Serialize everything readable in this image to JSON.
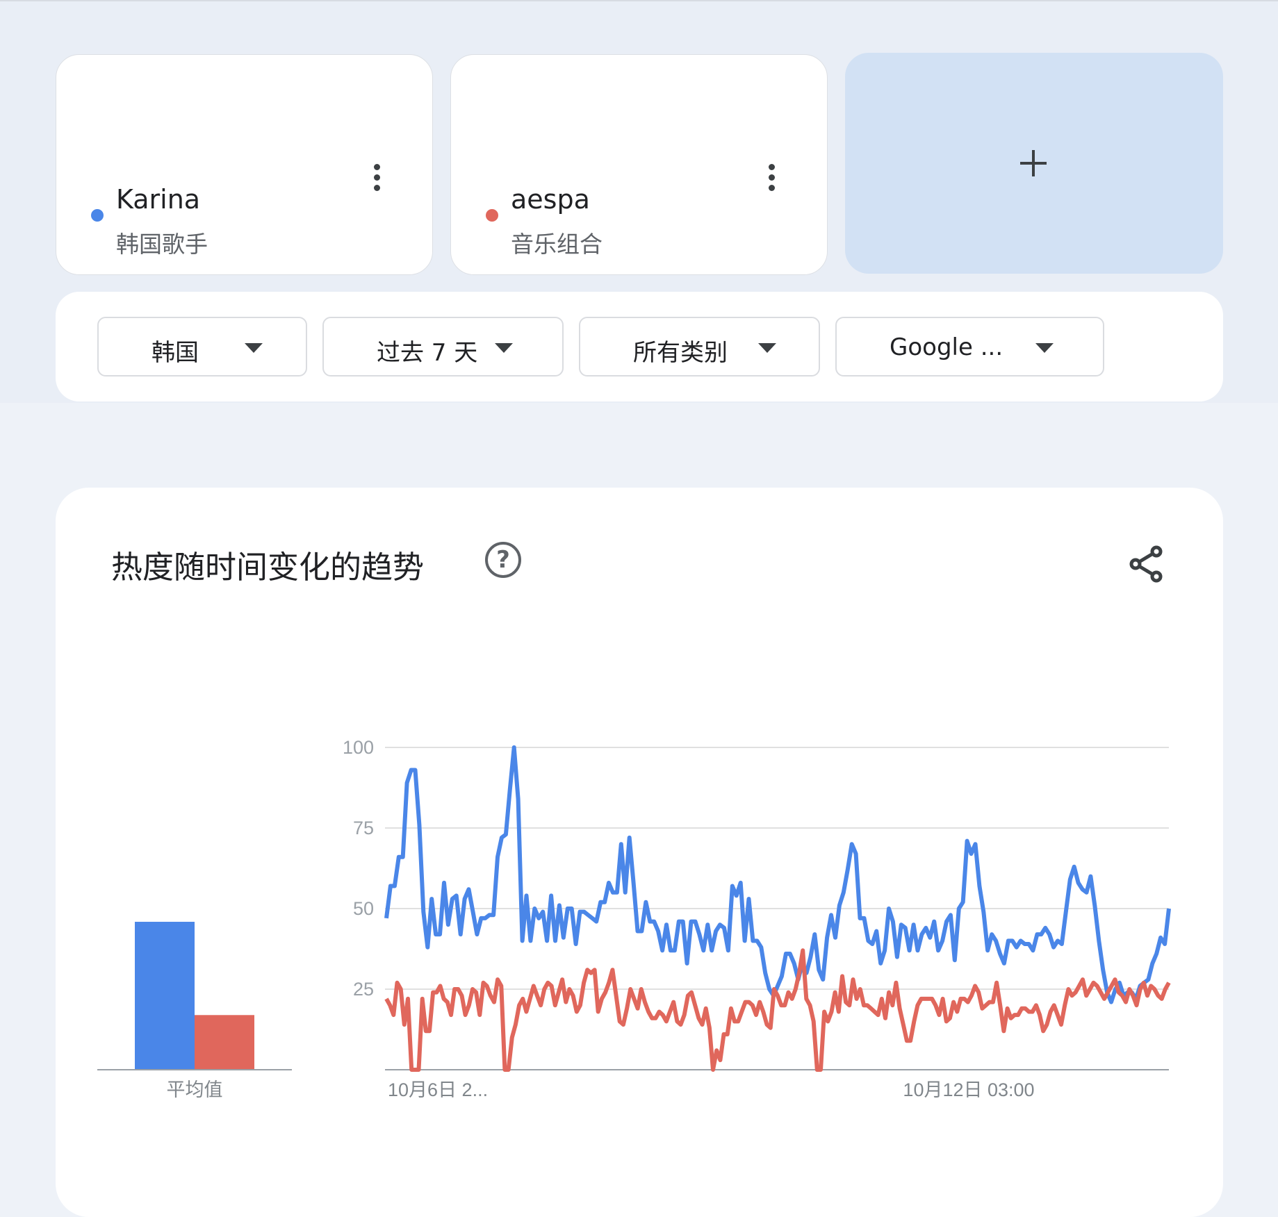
{
  "colors": {
    "karina": "#4a86e8",
    "aespa": "#e0675c"
  },
  "terms": [
    {
      "name": "Karina",
      "category": "韩国歌手"
    },
    {
      "name": "aespa",
      "category": "音乐组合"
    }
  ],
  "add_icon": "plus-icon",
  "filters": {
    "region": "韩国",
    "time": "过去 7 天",
    "category": "所有类别",
    "property": "Google ..."
  },
  "chart_section": {
    "title": "热度随时间变化的趋势",
    "help_icon": "help-circle-icon",
    "share_icon": "share-icon"
  },
  "chart_data": [
    {
      "type": "bar",
      "categories": [
        "平均值"
      ],
      "series": [
        {
          "name": "Karina",
          "values": [
            46
          ]
        },
        {
          "name": "aespa",
          "values": [
            17
          ]
        }
      ],
      "ylim": [
        0,
        100
      ]
    },
    {
      "type": "line",
      "x_tick_labels": [
        "10月6日 2...",
        "10月12日 03:00"
      ],
      "yticks": [
        25,
        50,
        75,
        100
      ],
      "ylim": [
        0,
        100
      ],
      "grid": true,
      "series": [
        {
          "name": "Karina",
          "values": [
            47,
            57,
            57,
            66,
            66,
            89,
            93,
            93,
            76,
            49,
            38,
            53,
            42,
            42,
            58,
            45,
            53,
            54,
            42,
            53,
            56,
            49,
            42,
            47,
            47,
            48,
            48,
            66,
            72,
            73,
            87,
            100,
            84,
            40,
            54,
            40,
            50,
            47,
            49,
            40,
            54,
            40,
            51,
            41,
            50,
            50,
            39,
            49,
            49,
            48,
            47,
            46,
            52,
            52,
            58,
            55,
            55,
            70,
            55,
            72,
            58,
            43,
            43,
            52,
            46,
            46,
            43,
            37,
            45,
            37,
            37,
            46,
            46,
            33,
            46,
            46,
            42,
            37,
            45,
            37,
            43,
            45,
            44,
            37,
            57,
            54,
            58,
            40,
            53,
            40,
            40,
            38,
            30,
            25,
            23,
            26,
            29,
            36,
            36,
            33,
            28,
            33,
            30,
            35,
            42,
            31,
            28,
            41,
            48,
            41,
            51,
            55,
            62,
            70,
            67,
            47,
            47,
            40,
            39,
            43,
            33,
            37,
            50,
            46,
            35,
            45,
            44,
            37,
            45,
            37,
            42,
            44,
            41,
            46,
            37,
            40,
            46,
            48,
            34,
            50,
            52,
            71,
            67,
            70,
            57,
            49,
            37,
            42,
            40,
            36,
            33,
            40,
            40,
            38,
            40,
            39,
            39,
            37,
            42,
            42,
            44,
            42,
            38,
            40,
            39,
            49,
            59,
            63,
            58,
            56,
            55,
            60,
            51,
            40,
            31,
            24,
            21,
            25,
            27,
            23,
            24,
            24,
            22,
            26,
            27,
            28,
            33,
            36,
            41,
            39,
            50
          ]
        },
        {
          "name": "aespa",
          "values": [
            22,
            20,
            17,
            27,
            25,
            14,
            22,
            0,
            0,
            0,
            22,
            12,
            12,
            24,
            24,
            26,
            22,
            21,
            17,
            25,
            25,
            23,
            17,
            20,
            25,
            24,
            17,
            27,
            26,
            23,
            21,
            28,
            26,
            0,
            0,
            10,
            14,
            20,
            22,
            18,
            22,
            26,
            23,
            20,
            25,
            27,
            26,
            20,
            24,
            28,
            21,
            25,
            23,
            18,
            20,
            27,
            31,
            30,
            31,
            18,
            22,
            24,
            27,
            31,
            23,
            15,
            14,
            19,
            25,
            22,
            19,
            25,
            21,
            18,
            16,
            16,
            18,
            17,
            15,
            18,
            21,
            15,
            14,
            17,
            23,
            24,
            20,
            16,
            14,
            19,
            13,
            0,
            6,
            3,
            11,
            11,
            19,
            15,
            15,
            18,
            21,
            21,
            20,
            17,
            21,
            18,
            14,
            13,
            25,
            23,
            20,
            20,
            24,
            22,
            25,
            30,
            37,
            22,
            20,
            15,
            0,
            0,
            18,
            15,
            18,
            24,
            18,
            29,
            21,
            20,
            28,
            22,
            25,
            20,
            20,
            19,
            18,
            17,
            22,
            16,
            24,
            20,
            27,
            19,
            14,
            9,
            9,
            15,
            20,
            22,
            22,
            22,
            22,
            20,
            17,
            22,
            15,
            16,
            21,
            18,
            22,
            22,
            21,
            23,
            26,
            24,
            19,
            20,
            21,
            21,
            27,
            20,
            12,
            19,
            16,
            17,
            17,
            19,
            19,
            18,
            18,
            20,
            17,
            12,
            14,
            18,
            20,
            17,
            14,
            20,
            25,
            23,
            24,
            26,
            28,
            23,
            25,
            27,
            26,
            24,
            22,
            24,
            26,
            28,
            24,
            23,
            21,
            25,
            23,
            20,
            25,
            27,
            23,
            26,
            25,
            23,
            22,
            25,
            27
          ]
        }
      ]
    }
  ]
}
